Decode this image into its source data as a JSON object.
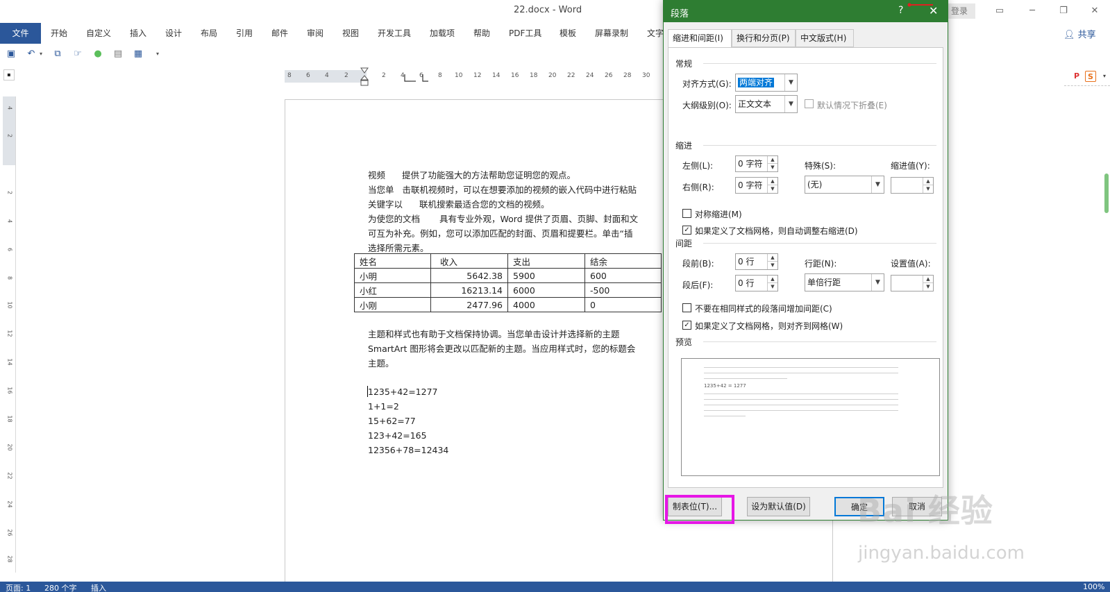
{
  "window": {
    "title": "22.docx  -  Word",
    "login_label": "登录"
  },
  "ribbon": {
    "tabs": [
      "文件",
      "开始",
      "自定义",
      "插入",
      "设计",
      "布局",
      "引用",
      "邮件",
      "审阅",
      "视图",
      "开发工具",
      "加载项",
      "帮助",
      "PDF工具",
      "模板",
      "屏幕录制",
      "文字"
    ],
    "share_label": "共享"
  },
  "ruler": {
    "h_numbers": [
      "8",
      "6",
      "4",
      "2",
      "2",
      "4",
      "6",
      "8",
      "10",
      "12",
      "14",
      "16",
      "18",
      "20",
      "22",
      "24",
      "26",
      "28",
      "30"
    ],
    "v_numbers": [
      "4",
      "2",
      "2",
      "4",
      "6",
      "8",
      "10",
      "12",
      "14",
      "16",
      "18",
      "20",
      "22",
      "24",
      "26",
      "28"
    ]
  },
  "document": {
    "lines": [
      {
        "a": "视频",
        "b": "提供了功能强大的方法帮助您证明您的观点。"
      },
      {
        "a": "当您单",
        "b": "击联机视频时，可以在想要添加的视频的嵌入代码中进行粘贴"
      },
      {
        "a": "关键字以",
        "b": "联机搜索最适合您的文档的视频。"
      },
      {
        "a": "为使您的文档",
        "b": "具有专业外观，Word 提供了页眉、页脚、封面和文"
      },
      {
        "a": "可互为补充。例如，您可以添加匹配的封面、页眉和提要栏。单击“插",
        "b": ""
      },
      {
        "a": "选择所需元素。",
        "b": ""
      }
    ],
    "table": {
      "headers": [
        "姓名",
        "收入",
        "支出",
        "结余"
      ],
      "rows": [
        [
          "小明",
          "5642.38",
          "5900",
          "600"
        ],
        [
          "小红",
          "16213.14",
          "6000",
          "-500"
        ],
        [
          "小刚",
          "2477.96",
          "4000",
          "0"
        ]
      ]
    },
    "lines2": [
      "主题和样式也有助于文档保持协调。当您单击设计并选择新的主题",
      "SmartArt 图形将会更改以匹配新的主题。当应用样式时，您的标题会",
      "主题。"
    ],
    "equations": [
      "1235+42=1277",
      "1+1=2",
      "15+62=77",
      "123+42=165",
      "12356+78=12434"
    ]
  },
  "status": {
    "page": "页面: 1",
    "words": "280 个字",
    "mode": "插入",
    "zoom": "100%"
  },
  "dialog": {
    "title": "段落",
    "help": "?",
    "close": "✕",
    "tabs": [
      "缩进和间距(I)",
      "换行和分页(P)",
      "中文版式(H)"
    ],
    "general": {
      "section": "常规",
      "align_label": "对齐方式(G):",
      "align_value": "两端对齐",
      "outline_label": "大纲级别(O):",
      "outline_value": "正文文本",
      "collapse_label": "默认情况下折叠(E)"
    },
    "indent": {
      "section": "缩进",
      "left_label": "左侧(L):",
      "left_value": "0 字符",
      "right_label": "右侧(R):",
      "right_value": "0 字符",
      "special_label": "特殊(S):",
      "special_value": "(无)",
      "by_label": "缩进值(Y):",
      "mirror_label": "对称缩进(M)",
      "auto_right_label": "如果定义了文档网格，则自动调整右缩进(D)"
    },
    "spacing": {
      "section": "间距",
      "before_label": "段前(B):",
      "before_value": "0 行",
      "after_label": "段后(F):",
      "after_value": "0 行",
      "line_label": "行距(N):",
      "line_value": "单倍行距",
      "at_label": "设置值(A):",
      "no_space_label": "不要在相同样式的段落间增加间距(C)",
      "snap_grid_label": "如果定义了文档网格，则对齐到网格(W)"
    },
    "preview": {
      "section": "预览",
      "sample_text": "1235+42  =  1277"
    },
    "buttons": {
      "tabs": "制表位(T)...",
      "default": "设为默认值(D)",
      "ok": "确定",
      "cancel": "取消"
    }
  },
  "watermark": {
    "brand": "Bai  经验",
    "url": "jingyan.baidu.com"
  }
}
